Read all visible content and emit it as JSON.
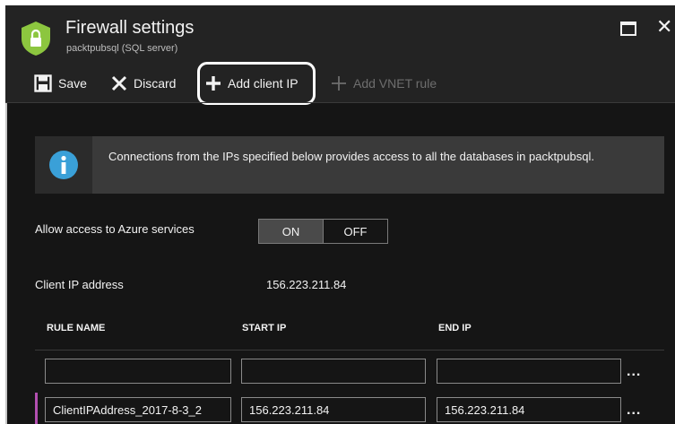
{
  "window": {
    "title": "Firewall settings",
    "subtitle": "packtpubsql (SQL server)"
  },
  "toolbar": {
    "save_label": "Save",
    "discard_label": "Discard",
    "add_client_ip_label": "Add client IP",
    "add_vnet_rule_label": "Add VNET rule"
  },
  "info": {
    "text": "Connections from the IPs specified below provides access to all the databases in packtpubsql."
  },
  "azure_access": {
    "label": "Allow access to Azure services",
    "on_label": "ON",
    "off_label": "OFF",
    "selected": "ON"
  },
  "client_ip": {
    "label": "Client IP address",
    "value": "156.223.211.84"
  },
  "table": {
    "columns": [
      "RULE NAME",
      "START IP",
      "END IP"
    ],
    "rows": [
      {
        "rule_name": "",
        "start_ip": "",
        "end_ip": "",
        "more": "..."
      },
      {
        "rule_name": "ClientIPAddress_2017-8-3_2",
        "start_ip": "156.223.211.84",
        "end_ip": "156.223.211.84",
        "more": "..."
      }
    ]
  },
  "colors": {
    "background": "#151515",
    "header": "#232323",
    "banner": "#3a3a3a",
    "shield_icon": "#8cc63f",
    "info_icon": "#3aa0d8",
    "row_marker": "#b24fb0"
  }
}
